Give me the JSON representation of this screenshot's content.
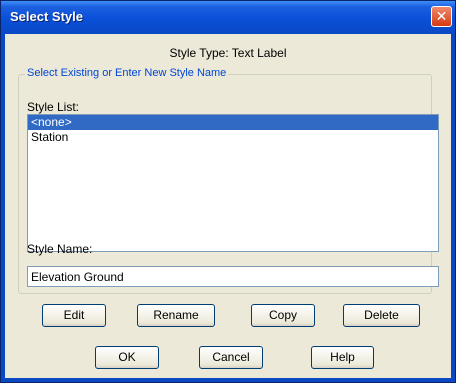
{
  "window": {
    "title": "Select Style",
    "close_label": "✕"
  },
  "style_type": "Style Type: Text Label",
  "group_label": "Select Existing or Enter New Style Name",
  "style_list": {
    "label": "Style List:",
    "items": [
      "<none>",
      "Station"
    ],
    "selected_index": 0
  },
  "style_name": {
    "label": "Style Name:",
    "value": "Elevation Ground"
  },
  "buttons": {
    "edit": "Edit",
    "rename": "Rename",
    "copy": "Copy",
    "delete": "Delete",
    "ok": "OK",
    "cancel": "Cancel",
    "help": "Help"
  },
  "colors": {
    "titlebar": "#0b49c4",
    "selection": "#316ac5",
    "group_label": "#0046d5"
  }
}
